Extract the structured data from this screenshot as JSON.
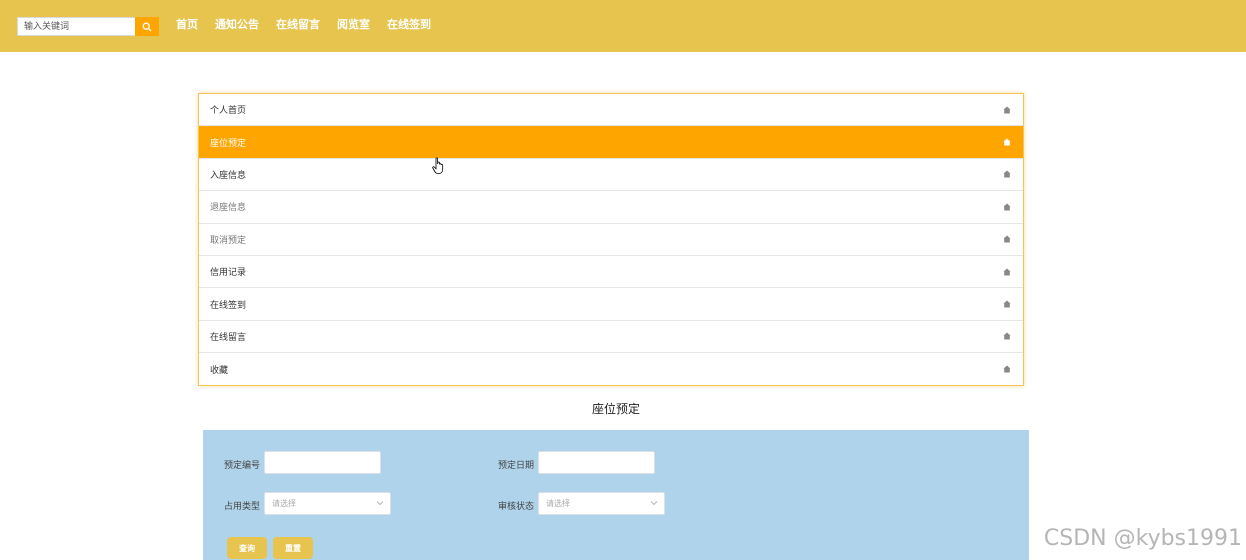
{
  "header": {
    "search_placeholder": "输入关键词",
    "nav": [
      "首页",
      "通知公告",
      "在线留言",
      "阅览室",
      "在线签到"
    ],
    "colors": {
      "bar": "#e6c44e",
      "accent": "#ffa500"
    }
  },
  "menu": {
    "items": [
      {
        "label": "个人首页",
        "state": "normal"
      },
      {
        "label": "座位预定",
        "state": "active"
      },
      {
        "label": "入座信息",
        "state": "normal"
      },
      {
        "label": "退座信息",
        "state": "muted"
      },
      {
        "label": "取消预定",
        "state": "muted"
      },
      {
        "label": "信用记录",
        "state": "normal"
      },
      {
        "label": "在线签到",
        "state": "normal"
      },
      {
        "label": "在线留言",
        "state": "normal"
      },
      {
        "label": "收藏",
        "state": "normal"
      }
    ],
    "icon": "home-icon"
  },
  "section": {
    "title": "座位预定"
  },
  "filter": {
    "booking_no_label": "预定编号",
    "booking_date_label": "预定日期",
    "use_type_label": "占用类型",
    "use_type_placeholder": "请选择",
    "review_status_label": "审核状态",
    "review_status_placeholder": "请选择",
    "query_button": "查询",
    "reset_button": "重置"
  },
  "watermark": "CSDN @kybs1991"
}
